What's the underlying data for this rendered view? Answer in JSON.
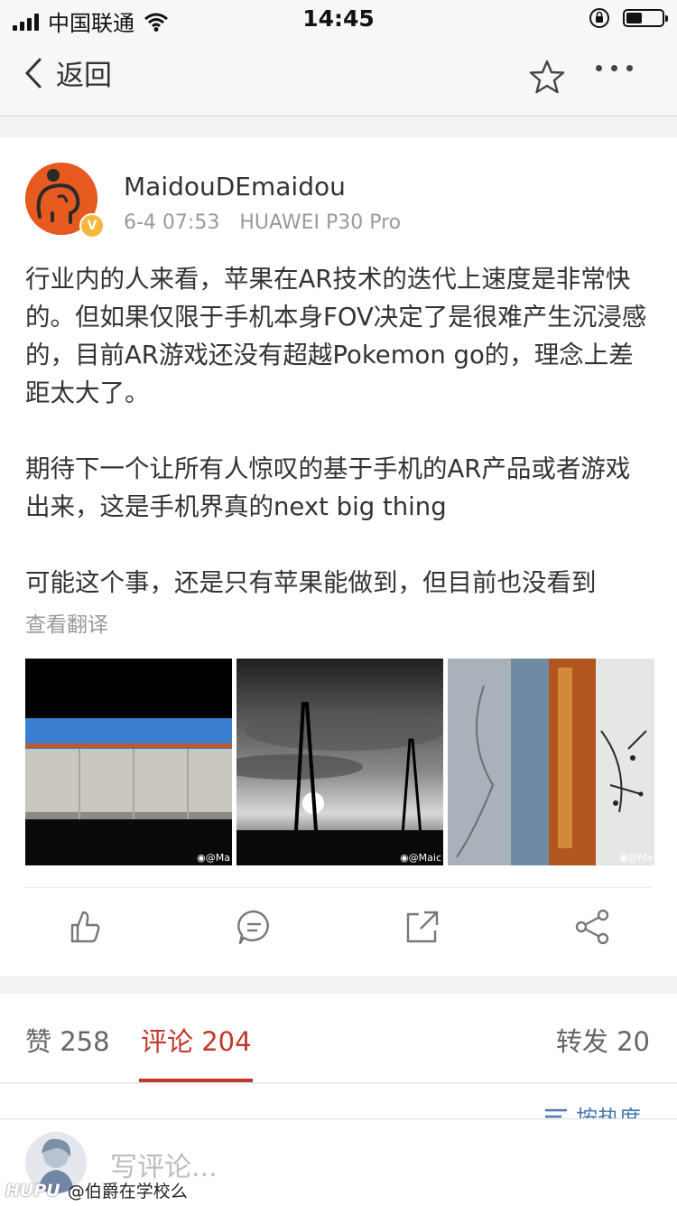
{
  "status_bar": {
    "carrier": "中国联通",
    "time": "14:45",
    "battery_level": 0.45
  },
  "nav": {
    "back_label": "返回"
  },
  "post": {
    "username": "MaidouDEmaidou",
    "time": "6-4 07:53",
    "device": "HUAWEI P30 Pro",
    "paragraphs": [
      "行业内的人来看，苹果在AR技术的迭代上速度是非常快的。但如果仅限于手机本身FOV决定了是很难产生沉浸感的，目前AR游戏还没有超越Pokemon go的，理念上差距太大了。",
      "期待下一个让所有人惊叹的基于手机的AR产品或者游戏出来，这是手机界真的next big thing",
      "可能这个事，还是只有苹果能做到，但目前也没看到"
    ],
    "translate_label": "查看翻译",
    "image_watermark": "◉@Ma",
    "image_watermark_2": "◉@Maic",
    "image_watermark_3": "◉@Ma"
  },
  "tabs": {
    "likes": "赞 258",
    "comments": "评论 204",
    "reposts": "转发 20"
  },
  "sort": {
    "label": "按热度"
  },
  "comment_bar": {
    "placeholder": "写评论..."
  },
  "footer": {
    "brand": "HUPU",
    "credit": "@伯爵在学校么"
  },
  "colors": {
    "accent": "#c0392b",
    "link": "#4a78b0",
    "badge": "#f6b93b"
  }
}
